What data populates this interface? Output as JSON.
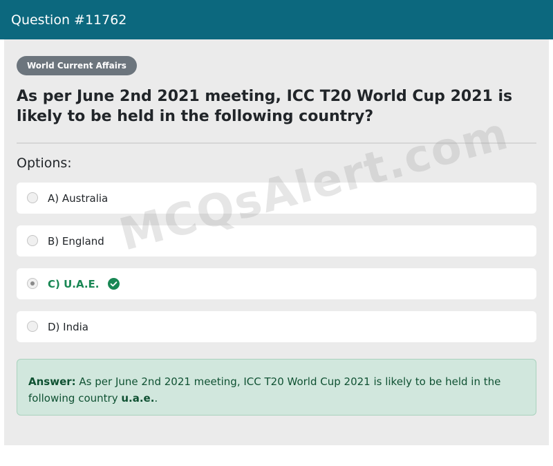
{
  "header": {
    "title": "Question #11762"
  },
  "category": "World Current Affairs",
  "question": "As per June 2nd 2021 meeting, ICC T20 World Cup 2021 is likely to be held in the following country?",
  "options_label": "Options:",
  "options": [
    {
      "label": "A) Australia",
      "selected": false,
      "correct": false
    },
    {
      "label": "B) England",
      "selected": false,
      "correct": false
    },
    {
      "label": "C) U.A.E.",
      "selected": true,
      "correct": true
    },
    {
      "label": "D) India",
      "selected": false,
      "correct": false
    }
  ],
  "answer": {
    "label": "Answer:",
    "text": " As per June 2nd 2021 meeting, ICC T20 World Cup 2021 is likely to be held in the following country ",
    "emphasis": "u.a.e.",
    "suffix": "."
  },
  "watermark": "MCQsAlert.com",
  "colors": {
    "header_bg": "#0c687e",
    "badge_bg": "#6c757d",
    "correct": "#198754",
    "answer_bg": "#d1e7dd"
  }
}
